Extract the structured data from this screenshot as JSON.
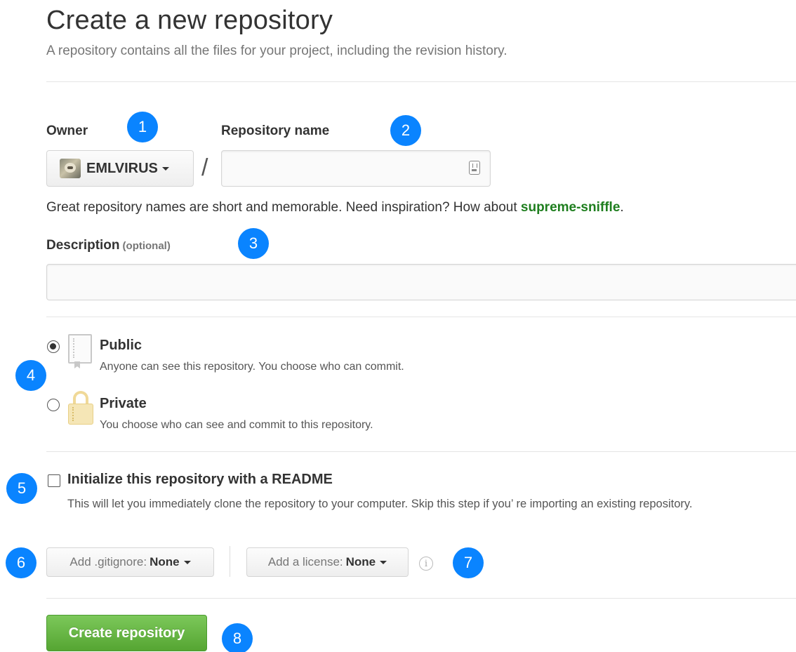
{
  "header": {
    "title": "Create a new repository",
    "subtitle": "A repository contains all the files for your project, including the revision history."
  },
  "owner": {
    "label": "Owner",
    "name": "EMLVIRUS"
  },
  "repo": {
    "label": "Repository name",
    "value": "",
    "placeholder": ""
  },
  "separator": "/",
  "hint": {
    "text": "Great repository names are short and memorable. Need inspiration? How about ",
    "suggestion": "supreme-sniffle",
    "end": "."
  },
  "description": {
    "label": "Description",
    "optional": "(optional)",
    "value": "",
    "placeholder": ""
  },
  "visibility": {
    "public": {
      "title": "Public",
      "desc": "Anyone can see this repository. You choose who can commit.",
      "icon": "repo-book-icon",
      "checked": true
    },
    "private": {
      "title": "Private",
      "desc": "You choose who can see and commit to this repository.",
      "icon": "lock-icon",
      "checked": false
    }
  },
  "init": {
    "title": "Initialize this repository with a README",
    "desc": "This will let you immediately clone the repository to your computer. Skip this step if you’ re importing an existing repository.",
    "checked": false
  },
  "gitignore": {
    "label": "Add .gitignore:",
    "value": "None"
  },
  "license": {
    "label": "Add a license:",
    "value": "None"
  },
  "submit": {
    "label": "Create repository"
  },
  "badges": [
    "1",
    "2",
    "3",
    "4",
    "5",
    "6",
    "7",
    "8"
  ],
  "colors": {
    "badge": "#0a84ff",
    "submit": "#55a532",
    "suggestion": "#1e7e1e"
  }
}
